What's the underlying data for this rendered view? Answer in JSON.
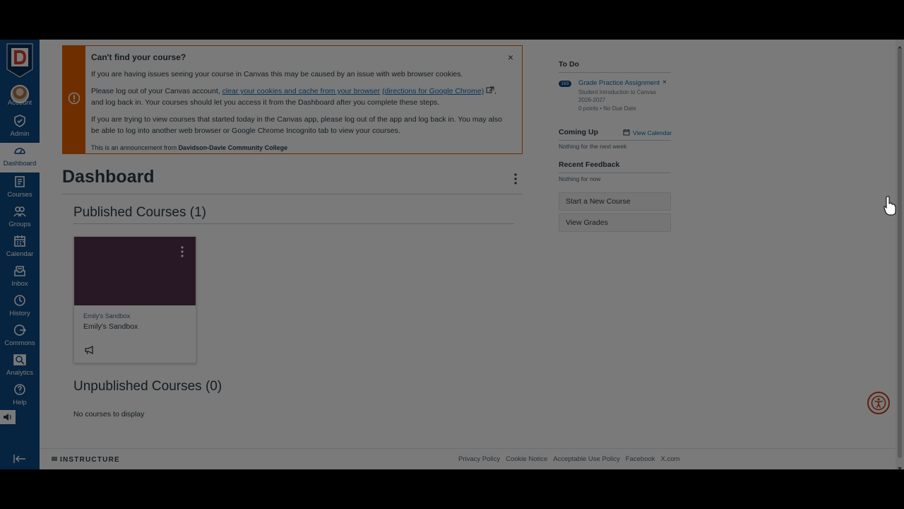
{
  "nav": {
    "items": [
      {
        "label": "Account",
        "icon": "avatar"
      },
      {
        "label": "Admin",
        "icon": "shield-icon"
      },
      {
        "label": "Dashboard",
        "icon": "dashboard-icon",
        "active": true
      },
      {
        "label": "Courses",
        "icon": "courses-icon"
      },
      {
        "label": "Groups",
        "icon": "groups-icon"
      },
      {
        "label": "Calendar",
        "icon": "calendar-icon"
      },
      {
        "label": "Inbox",
        "icon": "inbox-icon"
      },
      {
        "label": "History",
        "icon": "clock-icon"
      },
      {
        "label": "Commons",
        "icon": "commons-icon"
      },
      {
        "label": "Analytics",
        "icon": "analytics-icon"
      },
      {
        "label": "Help",
        "icon": "help-icon"
      }
    ]
  },
  "announcement": {
    "title": "Can't find your course?",
    "p1": "If you are having issues seeing your course in Canvas this may be caused by an issue with web browser cookies.",
    "p2_pre": "Please log out of your Canvas account, ",
    "p2_link1": "clear your cookies and cache from your browser",
    "p2_link2": "(directions for Google Chrome)",
    "p2_post": ", and log back in. Your courses should let you access it from the Dashboard after you complete these steps.",
    "p3": "If you are trying to view courses that started today in the Canvas app, please log out of the app and log back in. You may also be able to log into another web browser or Google Chrome Incognito tab to view your courses.",
    "footer_pre": "This is an announcement from ",
    "footer_org": "Davidson-Davie Community College",
    "close_symbol": "×"
  },
  "dashboard": {
    "title": "Dashboard",
    "published_heading": "Published Courses (1)",
    "unpublished_heading": "Unpublished Courses (0)",
    "no_courses": "No courses to display",
    "course_card": {
      "short_name": "Emily's Sandbox",
      "name": "Emily's Sandbox",
      "color": "#54304f"
    }
  },
  "sidebar": {
    "todo_heading": "To Do",
    "todo_item": {
      "badge": "193",
      "title": "Grade Practice Assignment",
      "course": "Student Introduction to Canvas 2026-2027",
      "meta": "0 points • No Due Date",
      "close_symbol": "×"
    },
    "coming_up_heading": "Coming Up",
    "view_calendar": "View Calendar",
    "coming_up_empty": "Nothing for the next week",
    "feedback_heading": "Recent Feedback",
    "feedback_empty": "Nothing for now",
    "start_course_btn": "Start a New Course",
    "view_grades_btn": "View Grades"
  },
  "footer": {
    "brand": "INSTRUCTURE",
    "links": [
      "Privacy Policy",
      "Cookie Notice",
      "Acceptable Use Policy",
      "Facebook",
      "X.com"
    ]
  },
  "colors": {
    "nav_bg": "#0d4a86",
    "alert": "#e66000",
    "link": "#0b6fb7",
    "course_card": "#54304f"
  }
}
